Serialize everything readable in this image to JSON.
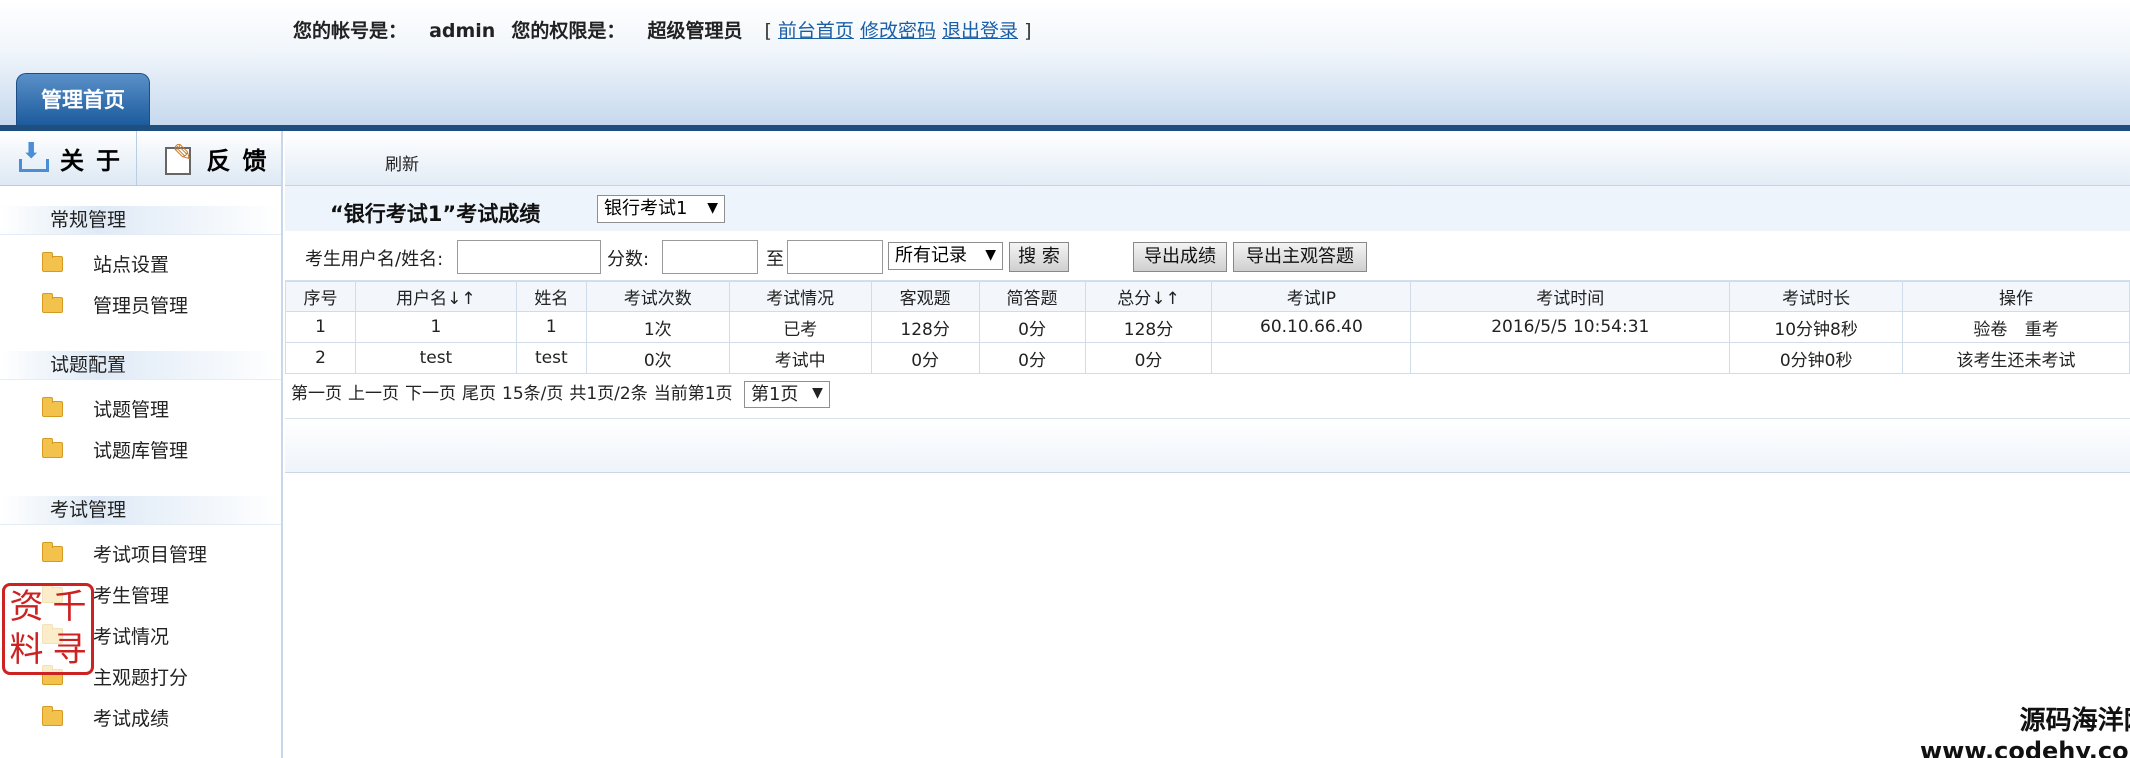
{
  "header": {
    "account_label": "您的帐号是：",
    "account_value": "admin",
    "perm_label": "您的权限是：",
    "perm_value": "超级管理员",
    "bracket_open": "[",
    "bracket_close": "]",
    "links": [
      "前台首页",
      "修改密码",
      "退出登录"
    ],
    "main_tab": "管理首页",
    "link_color": "#1a5fa6",
    "accent": "#1f4f7e"
  },
  "sidebar": {
    "tools": [
      {
        "label": "关于",
        "icon": "download-icon"
      },
      {
        "label": "反馈",
        "icon": "edit-icon"
      }
    ],
    "groups": [
      {
        "title": "常规管理",
        "items": [
          "站点设置",
          "管理员管理"
        ]
      },
      {
        "title": "试题配置",
        "items": [
          "试题管理",
          "试题库管理"
        ]
      },
      {
        "title": "考试管理",
        "items": [
          "考试项目管理",
          "考生管理",
          "考试情况",
          "主观题打分",
          "考试成绩"
        ]
      }
    ]
  },
  "toolbar": {
    "refresh": "刷新"
  },
  "title_row": {
    "title": "“银行考试1”考试成绩",
    "exam_select": "银行考试1"
  },
  "filters": {
    "user_label": "考生用户名/姓名:",
    "score_label": "分数:",
    "to_label": "至",
    "record_select": "所有记录",
    "search_btn": "搜 索",
    "export_btn": "导出成绩",
    "export_subj_btn": "导出主观答题"
  },
  "table": {
    "headers": [
      "序号",
      "用户名↓↑",
      "姓名",
      "考试次数",
      "考试情况",
      "客观题",
      "简答题",
      "总分↓↑",
      "考试IP",
      "考试时间",
      "考试时长",
      "操作"
    ],
    "rows": [
      [
        "1",
        "1",
        "1",
        "1次",
        "已考",
        "128分",
        "0分",
        "128分",
        "60.10.66.40",
        "2016/5/5 10:54:31",
        "10分钟8秒",
        "验卷",
        "重考"
      ],
      [
        "2",
        "test",
        "test",
        "0次",
        "考试中",
        "0分",
        "0分",
        "0分",
        "",
        "",
        "0分钟0秒",
        "该考生还未考试",
        ""
      ]
    ],
    "status_colors": {
      "done": "#1ba11b",
      "in_progress": "#1a2fb0"
    }
  },
  "pager": {
    "first": "第一页",
    "prev": "上一页",
    "next": "下一页",
    "last": "尾页",
    "per_page": "15条/页",
    "summary": "共1页/2条",
    "current": "当前第1页",
    "page_select": "第1页"
  },
  "watermark": {
    "stamp_chars": [
      "资",
      "千",
      "料",
      "寻"
    ],
    "brand_cn": "源码海洋网",
    "brand_url": "www.codehy.com"
  }
}
